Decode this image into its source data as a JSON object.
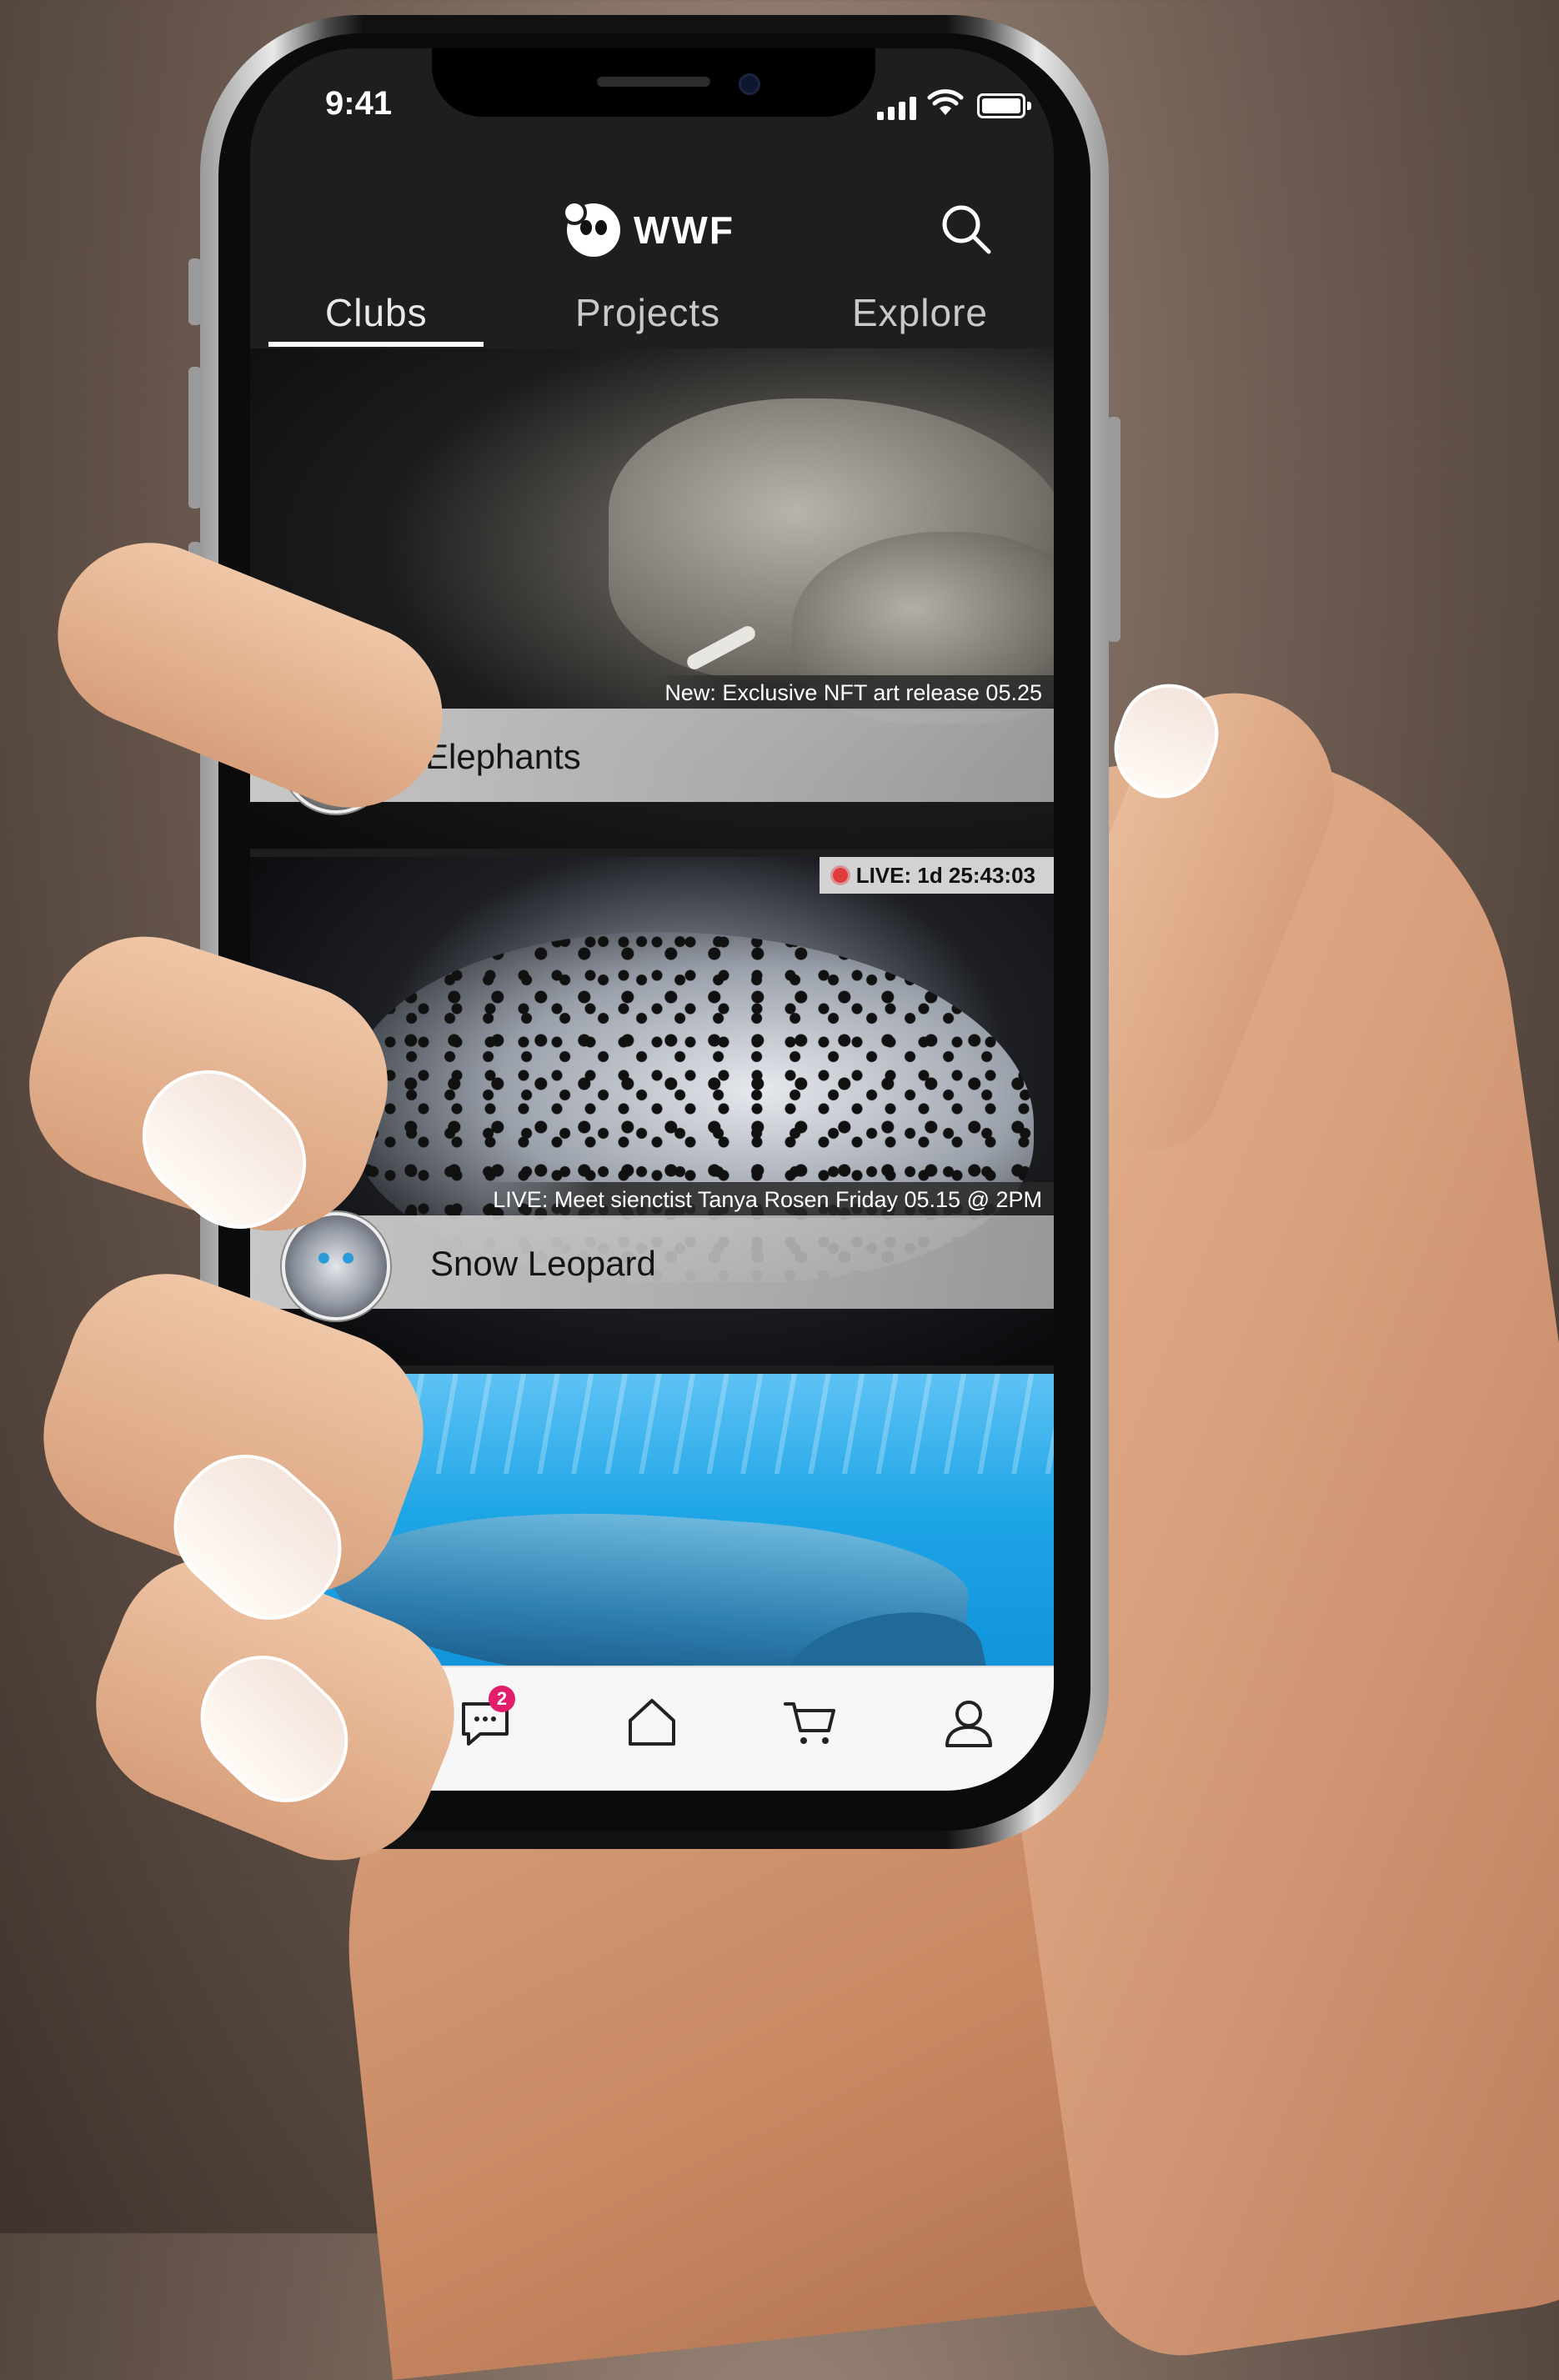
{
  "status_bar": {
    "time": "9:41"
  },
  "header": {
    "brand": "WWF"
  },
  "tabs": [
    {
      "label": "Clubs",
      "active": true
    },
    {
      "label": "Projects",
      "active": false
    },
    {
      "label": "Explore",
      "active": false
    }
  ],
  "feed": [
    {
      "club": "Elephants",
      "announcement": "New: Exclusive NFT art release 05.25"
    },
    {
      "club": "Snow Leopard",
      "live_badge": "LIVE: 1d 25:43:03",
      "announcement": "LIVE: Meet sienctist Tanya Rosen Friday 05.15 @ 2PM"
    },
    {
      "club": ""
    }
  ],
  "bottom_nav": {
    "items": [
      "bell-icon",
      "chat-icon",
      "home-icon",
      "cart-icon",
      "profile-icon"
    ],
    "chat_badge": "2"
  },
  "colors": {
    "badge": "#e21d6b",
    "live_dot": "#e23c3c",
    "app_bar": "#1e1e1e"
  }
}
